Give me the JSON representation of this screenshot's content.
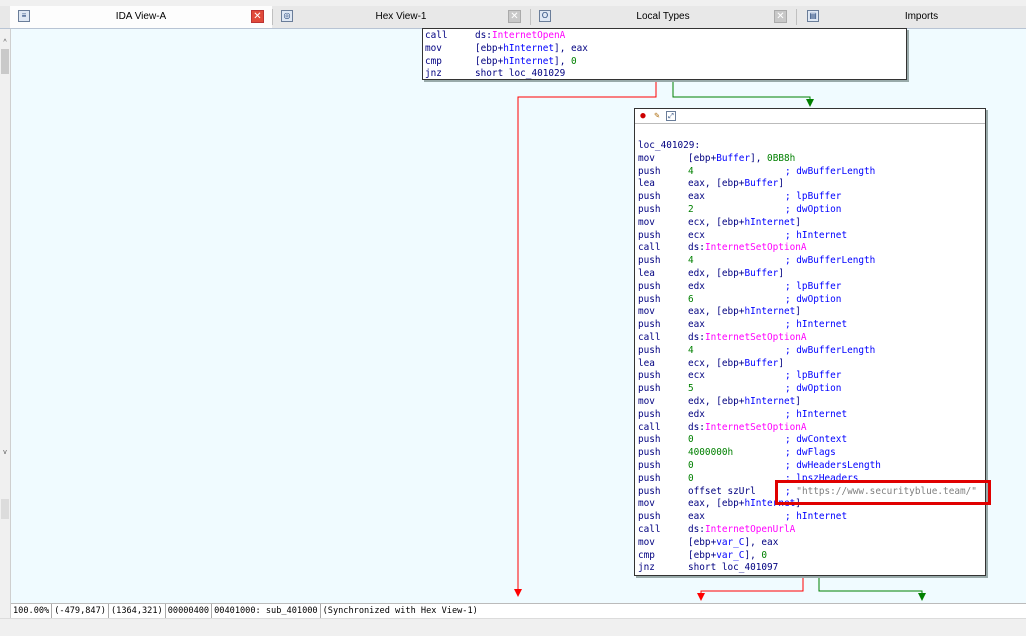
{
  "tabs": [
    {
      "label": "IDA View-A",
      "icon": "disasm-view-icon",
      "active": true
    },
    {
      "label": "Hex View-1",
      "icon": "hex-view-icon",
      "active": false
    },
    {
      "label": "Local Types",
      "icon": "local-types-icon",
      "active": false
    },
    {
      "label": "Imports",
      "icon": "imports-icon",
      "active": false
    }
  ],
  "top_node": {
    "lines": [
      [
        "call",
        "ds:InternetOpenA",
        ""
      ],
      [
        "mov",
        "[ebp+hInternet], eax",
        ""
      ],
      [
        "cmp",
        "[ebp+hInternet], 0",
        ""
      ],
      [
        "jnz",
        "short loc_401029",
        ""
      ]
    ]
  },
  "main_node": {
    "label": "loc_401029:",
    "lines": [
      [
        "mov",
        "[ebp+Buffer], 0BB8h",
        ""
      ],
      [
        "push",
        "4",
        "; dwBufferLength"
      ],
      [
        "lea",
        "eax, [ebp+Buffer]",
        ""
      ],
      [
        "push",
        "eax",
        "; lpBuffer"
      ],
      [
        "push",
        "2",
        "; dwOption"
      ],
      [
        "mov",
        "ecx, [ebp+hInternet]",
        ""
      ],
      [
        "push",
        "ecx",
        "; hInternet"
      ],
      [
        "call",
        "ds:InternetSetOptionA",
        ""
      ],
      [
        "push",
        "4",
        "; dwBufferLength"
      ],
      [
        "lea",
        "edx, [ebp+Buffer]",
        ""
      ],
      [
        "push",
        "edx",
        "; lpBuffer"
      ],
      [
        "push",
        "6",
        "; dwOption"
      ],
      [
        "mov",
        "eax, [ebp+hInternet]",
        ""
      ],
      [
        "push",
        "eax",
        "; hInternet"
      ],
      [
        "call",
        "ds:InternetSetOptionA",
        ""
      ],
      [
        "push",
        "4",
        "; dwBufferLength"
      ],
      [
        "lea",
        "ecx, [ebp+Buffer]",
        ""
      ],
      [
        "push",
        "ecx",
        "; lpBuffer"
      ],
      [
        "push",
        "5",
        "; dwOption"
      ],
      [
        "mov",
        "edx, [ebp+hInternet]",
        ""
      ],
      [
        "push",
        "edx",
        "; hInternet"
      ],
      [
        "call",
        "ds:InternetSetOptionA",
        ""
      ],
      [
        "push",
        "0",
        "; dwContext"
      ],
      [
        "push",
        "4000000h",
        "; dwFlags"
      ],
      [
        "push",
        "0",
        "; dwHeadersLength"
      ],
      [
        "push",
        "0",
        "; lpszHeaders"
      ],
      [
        "push",
        "offset szUrl",
        "; \"https://www.securityblue.team/\""
      ],
      [
        "mov",
        "eax, [ebp+hInternet]",
        ""
      ],
      [
        "push",
        "eax",
        "; hInternet"
      ],
      [
        "call",
        "ds:InternetOpenUrlA",
        ""
      ],
      [
        "mov",
        "[ebp+var_C], eax",
        ""
      ],
      [
        "cmp",
        "[ebp+var_C], 0",
        ""
      ],
      [
        "jnz",
        "short loc_401097",
        ""
      ]
    ]
  },
  "status": {
    "zoom": "100.00%",
    "coords": "(-479,847)",
    "pos": "(1364,321)",
    "offset": "00000400",
    "address": "00401000: sub_401000",
    "sync": "(Synchronized with Hex View-1)"
  },
  "colors": {
    "edge_false": "#ff0000",
    "edge_true": "#008000",
    "canvas": "#f0fbff"
  }
}
